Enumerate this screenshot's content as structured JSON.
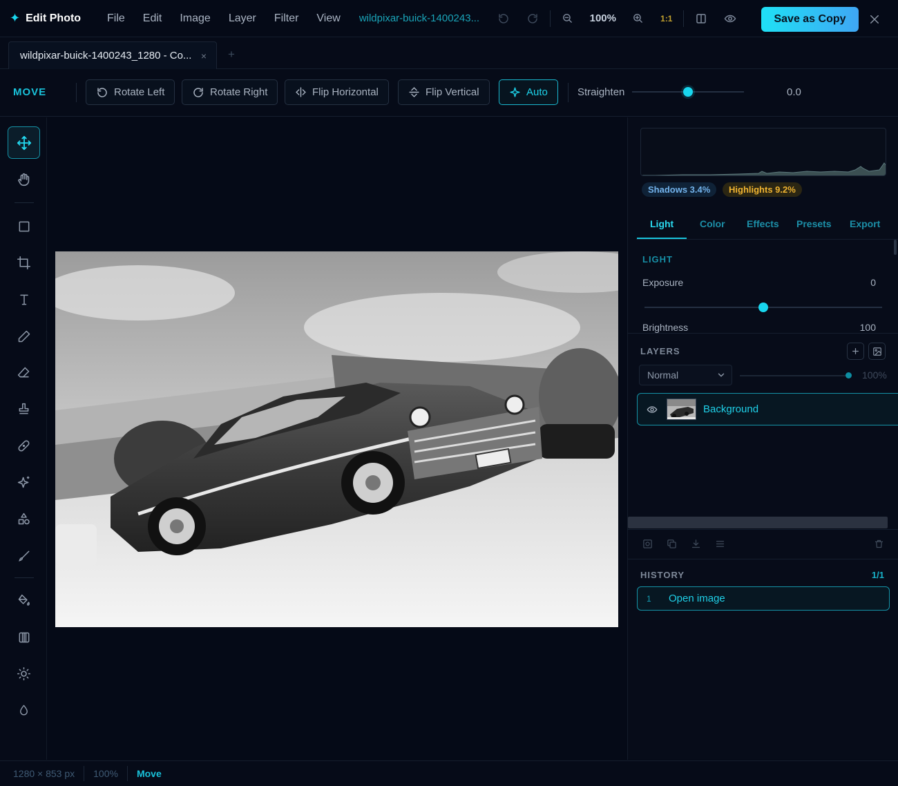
{
  "app": {
    "name": "Edit Photo"
  },
  "menu": [
    "File",
    "Edit",
    "Image",
    "Layer",
    "Filter",
    "View"
  ],
  "document": {
    "short_name": "wildpixar-buick-1400243...",
    "tab_label": "wildpixar-buick-1400243_1280 - Co...",
    "tab_close": "×",
    "tab_add": "+"
  },
  "zoom": {
    "value": "100%",
    "one_to_one": "1:1"
  },
  "save_button": "Save as Copy",
  "toolbar": {
    "mode": "MOVE",
    "rotate_left": "Rotate Left",
    "rotate_right": "Rotate Right",
    "flip_horizontal": "Flip Horizontal",
    "flip_vertical": "Flip Vertical",
    "auto": "Auto",
    "straighten_label": "Straighten",
    "straighten_value": "0.0",
    "straighten_fraction": 0.5
  },
  "histogram": {
    "shadows": "Shadows 3.4%",
    "highlights": "Highlights 9.2%"
  },
  "panel_tabs": [
    "Light",
    "Color",
    "Effects",
    "Presets",
    "Export"
  ],
  "light": {
    "title": "LIGHT",
    "exposure_label": "Exposure",
    "exposure_value": "0",
    "exposure_fraction": 0.5,
    "brightness_label": "Brightness",
    "brightness_value": "100"
  },
  "layers": {
    "title": "LAYERS",
    "blend_mode": "Normal",
    "opacity": "100%",
    "opacity_fraction": 1.0,
    "items": [
      {
        "name": "Background"
      }
    ]
  },
  "history": {
    "title": "HISTORY",
    "count": "1/1",
    "items": [
      {
        "num": "1",
        "name": "Open image"
      }
    ]
  },
  "status": {
    "dimensions": "1280 × 853 px",
    "zoom": "100%",
    "mode": "Move"
  },
  "colors": {
    "accent": "#19d6ee",
    "save_start": "#1fe0f5",
    "save_end": "#3fa7f5",
    "highlight_badge": "#f0b431",
    "shadow_badge": "#73b3ec"
  }
}
